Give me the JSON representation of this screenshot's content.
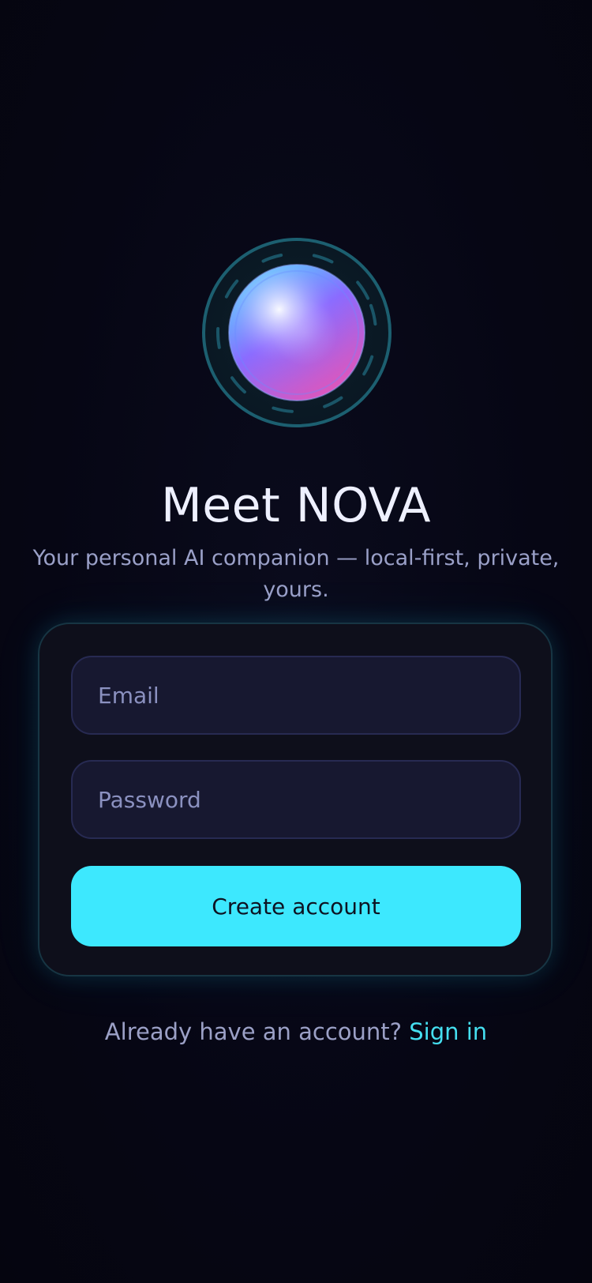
{
  "app": {
    "name": "NOVA",
    "accent_color": "#3de8fe",
    "background_color": "#060614"
  },
  "hero": {
    "logo_icon": "nova-orb-icon",
    "title": "Meet NOVA",
    "subtitle": "Your personal AI companion — local-first, private, yours."
  },
  "form": {
    "email": {
      "placeholder": "Email",
      "value": ""
    },
    "password": {
      "placeholder": "Password",
      "value": ""
    },
    "submit_label": "Create account"
  },
  "footer": {
    "prompt": "Already have an account?",
    "link_label": "Sign in"
  }
}
